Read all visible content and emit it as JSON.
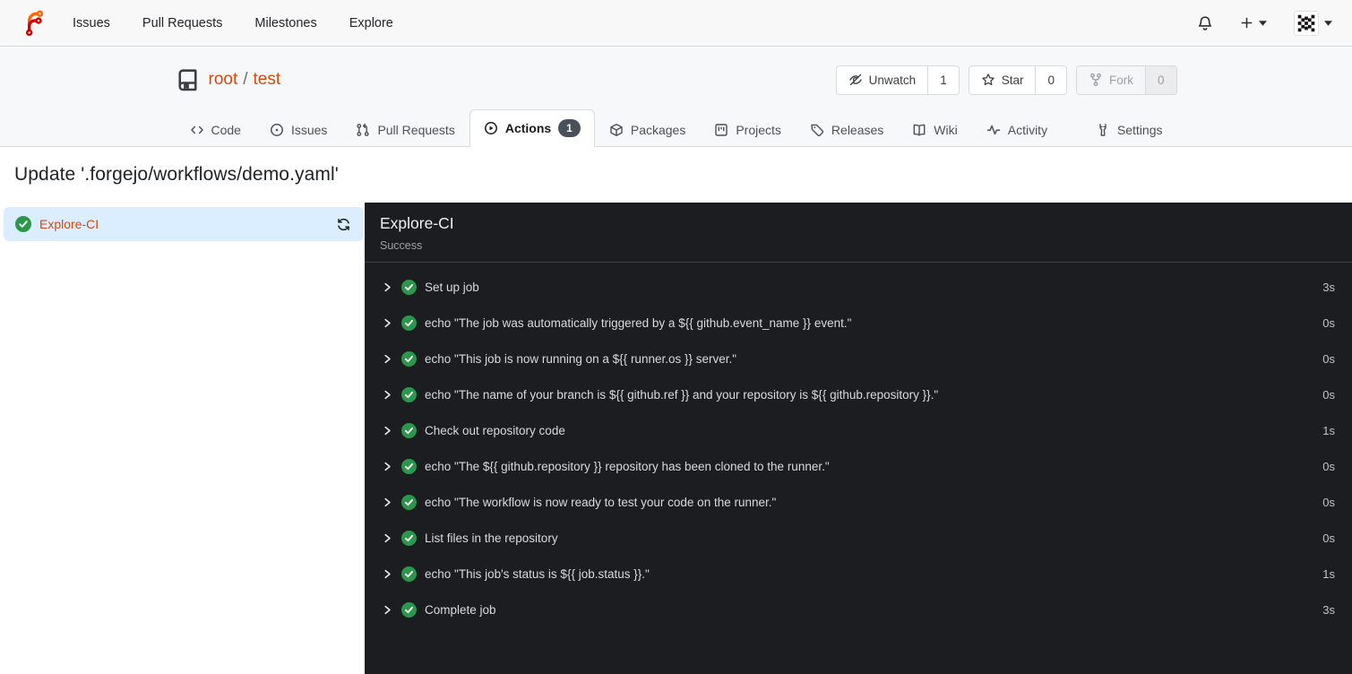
{
  "navbar": {
    "links": [
      {
        "label": "Issues"
      },
      {
        "label": "Pull Requests"
      },
      {
        "label": "Milestones"
      },
      {
        "label": "Explore"
      }
    ]
  },
  "repo": {
    "owner": "root",
    "separator": "/",
    "name": "test",
    "watch": {
      "label": "Unwatch",
      "count": "1"
    },
    "star": {
      "label": "Star",
      "count": "0"
    },
    "fork": {
      "label": "Fork",
      "count": "0"
    },
    "tabs": [
      {
        "label": "Code"
      },
      {
        "label": "Issues"
      },
      {
        "label": "Pull Requests"
      },
      {
        "label": "Actions",
        "badge": "1"
      },
      {
        "label": "Packages"
      },
      {
        "label": "Projects"
      },
      {
        "label": "Releases"
      },
      {
        "label": "Wiki"
      },
      {
        "label": "Activity"
      }
    ],
    "settings_tab": {
      "label": "Settings"
    }
  },
  "page": {
    "title": "Update '.forgejo/workflows/demo.yaml'"
  },
  "sidebar": {
    "job": {
      "name": "Explore-CI",
      "status": "success"
    }
  },
  "run_panel": {
    "job_name": "Explore-CI",
    "status_text": "Success",
    "steps": [
      {
        "name": "Set up job",
        "duration": "3s"
      },
      {
        "name": "echo \"The job was automatically triggered by a ${{ github.event_name }} event.\"",
        "duration": "0s"
      },
      {
        "name": "echo \"This job is now running on a ${{ runner.os }} server.\"",
        "duration": "0s"
      },
      {
        "name": "echo \"The name of your branch is ${{ github.ref }} and your repository is ${{ github.repository }}.\"",
        "duration": "0s"
      },
      {
        "name": "Check out repository code",
        "duration": "1s"
      },
      {
        "name": "echo \"The ${{ github.repository }} repository has been cloned to the runner.\"",
        "duration": "0s"
      },
      {
        "name": "echo \"The workflow is now ready to test your code on the runner.\"",
        "duration": "0s"
      },
      {
        "name": "List files in the repository",
        "duration": "0s"
      },
      {
        "name": "echo \"This job's status is ${{ job.status }}.\"",
        "duration": "1s"
      },
      {
        "name": "Complete job",
        "duration": "3s"
      }
    ]
  },
  "colors": {
    "primary_link": "#cf4b10",
    "success_green": "#2c974b",
    "panel_bg": "#1b1d20",
    "selected_job_bg": "#dbeeff",
    "badge_bg": "#485059"
  }
}
